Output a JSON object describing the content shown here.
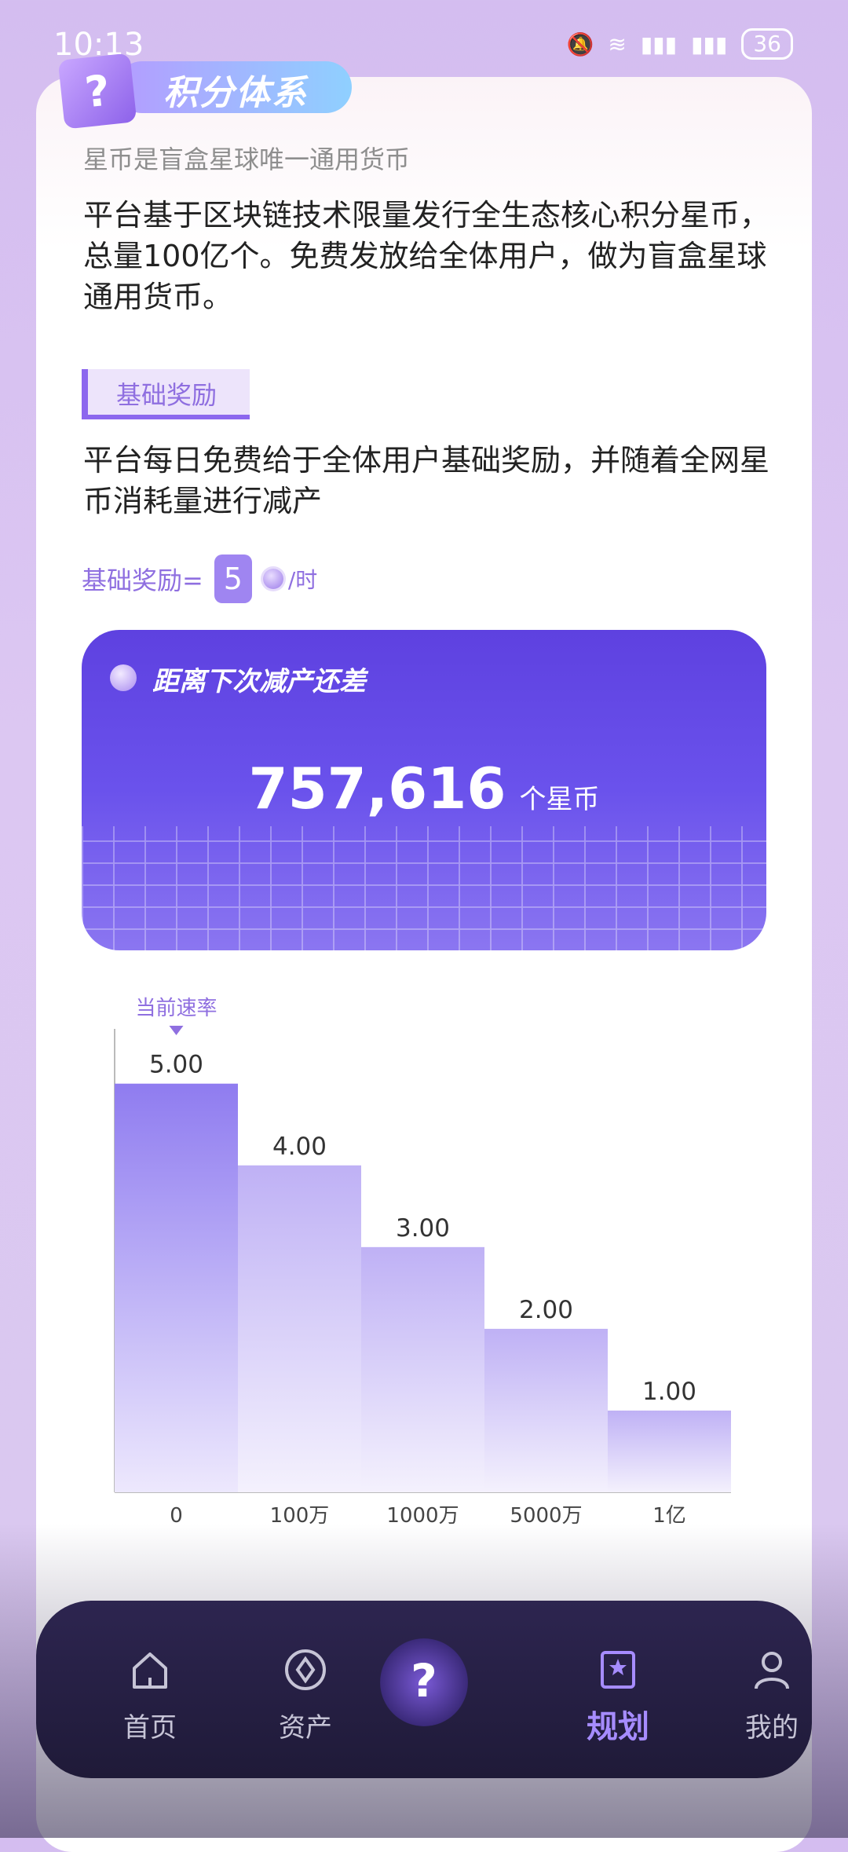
{
  "status": {
    "time": "10:13",
    "battery": "36"
  },
  "badge": {
    "title": "积分体系",
    "box_glyph": "?"
  },
  "intro": {
    "subtitle": "星币是盲盒星球唯一通用货币",
    "paragraph": "平台基于区块链技术限量发行全生态核心积分星币，总量100亿个。免费发放给全体用户，做为盲盒星球通用货币。"
  },
  "base_reward": {
    "tag": "基础奖励",
    "paragraph": "平台每日免费给于全体用户基础奖励，并随着全网星币消耗量进行减产",
    "formula_label": "基础奖励=",
    "formula_value": "5",
    "formula_unit": "/时"
  },
  "countdown": {
    "title": "距离下次减产还差",
    "value": "757,616",
    "unit": "个星币"
  },
  "chart_data": {
    "type": "bar",
    "categories": [
      "0",
      "100万",
      "1000万",
      "5000万",
      "1亿"
    ],
    "values": [
      5.0,
      4.0,
      3.0,
      2.0,
      1.0
    ],
    "value_labels": [
      "5.00",
      "4.00",
      "3.00",
      "2.00",
      "1.00"
    ],
    "annotation": "当前速率",
    "ylim": [
      0,
      5.67
    ],
    "grid": false
  },
  "nav": {
    "items": [
      {
        "label": "首页",
        "icon": "home-icon"
      },
      {
        "label": "资产",
        "icon": "diamond-icon"
      },
      {
        "label": "",
        "icon": "mystery-box-icon"
      },
      {
        "label": "规划",
        "icon": "star-book-icon"
      },
      {
        "label": "我的",
        "icon": "user-icon"
      }
    ]
  },
  "colors": {
    "accent": "#8c67ee",
    "banner": "#5e41e0",
    "nav_bg": "#231d3f"
  }
}
